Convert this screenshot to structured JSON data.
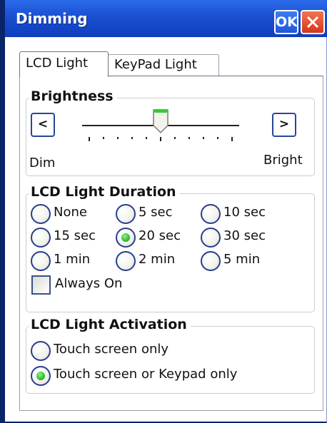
{
  "window": {
    "title": "Dimming",
    "ok_label": "OK"
  },
  "tabs": [
    {
      "label": "LCD Light",
      "active": true
    },
    {
      "label": "KeyPad Light",
      "active": false
    }
  ],
  "brightness": {
    "title": "Brightness",
    "decrease_label": "<",
    "increase_label": ">",
    "min_label": "Dim",
    "max_label": "Bright",
    "level": 5,
    "max_level": 10
  },
  "duration": {
    "title": "LCD Light Duration",
    "options": [
      "None",
      "5 sec",
      "10 sec",
      "15 sec",
      "20 sec",
      "30 sec",
      "1 min",
      "2 min",
      "5 min"
    ],
    "selected": "20 sec",
    "always_on_label": "Always On",
    "always_on_checked": false
  },
  "activation": {
    "title": "LCD Light Activation",
    "options": [
      "Touch screen only",
      "Touch screen or Keypad only"
    ],
    "selected": "Touch screen or Keypad only"
  },
  "colors": {
    "titlebar": "#1a4fd2",
    "radio_selected": "#2fbd2f",
    "close_button": "#d4381a"
  }
}
